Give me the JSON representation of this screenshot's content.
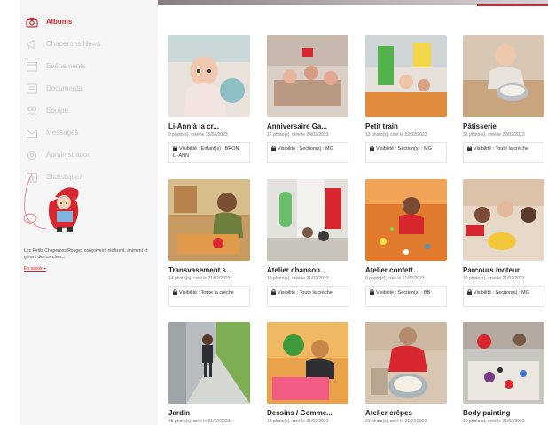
{
  "nav": [
    {
      "key": "albums",
      "label": "Albums",
      "icon": "camera-icon",
      "active": true
    },
    {
      "key": "chaperons-news",
      "label": "Chaperons News",
      "icon": "megaphone-icon",
      "active": false
    },
    {
      "key": "evenements",
      "label": "Evénements",
      "icon": "calendar-icon",
      "active": false
    },
    {
      "key": "documents",
      "label": "Documents",
      "icon": "document-icon",
      "active": false
    },
    {
      "key": "equipe",
      "label": "Equipe",
      "icon": "team-icon",
      "active": false
    },
    {
      "key": "messages",
      "label": "Messages",
      "icon": "envelope-icon",
      "active": false
    },
    {
      "key": "administration",
      "label": "Administration",
      "icon": "gear-icon",
      "active": false
    },
    {
      "key": "statistiques",
      "label": "Statistiques",
      "icon": "chart-icon",
      "active": false
    }
  ],
  "about": {
    "text": "Les Petits Chaperons Rouges conçoivent, réalisent, animent et gèrent des crèches...",
    "link": "En savoir +"
  },
  "colors": {
    "accent": "#d8262e",
    "sidebar_bg": "#f6f6f6"
  },
  "albums": [
    {
      "title": "Li-Ann à la cr...",
      "meta": "9 photo(s), créé le 15/03/2023",
      "visibility": "Visibilité : Enfant(s) : BRON LI-ANN"
    },
    {
      "title": "Anniversaire Ga...",
      "meta": "17 photo(s), créé le 24/02/2023",
      "visibility": "Visibilité : Section(s) : MG"
    },
    {
      "title": "Petit train",
      "meta": "13 photo(s), créé le 22/02/2023",
      "visibility": "Visibilité : Section(s) : MG"
    },
    {
      "title": "Pâtisserie",
      "meta": "31 photo(s), créé le 22/02/2023",
      "visibility": "Visibilité : Toute la crèche"
    },
    {
      "title": "Transvasement s...",
      "meta": "14 photo(s), créé le 21/02/2023",
      "visibility": "Visibilité : Toute la crèche"
    },
    {
      "title": "Atelier chanson...",
      "meta": "18 photo(s), créé le 21/02/2023",
      "visibility": "Visibilité : Toute la crèche"
    },
    {
      "title": "Atelier confett...",
      "meta": "9 photo(s), créé le 21/02/2023",
      "visibility": "Visibilité : Section(s) : BB"
    },
    {
      "title": "Parcours moteur",
      "meta": "30 photo(s), créé le 21/02/2023",
      "visibility": "Visibilité : Section(s) : MG"
    },
    {
      "title": "Jardin",
      "meta": "45 photo(s), créé le 21/02/2023",
      "visibility": ""
    },
    {
      "title": "Dessins / Gomme...",
      "meta": "18 photo(s), créé le 21/02/2023",
      "visibility": ""
    },
    {
      "title": "Atelier crêpes",
      "meta": "21 photo(s), créé le 21/02/2023",
      "visibility": ""
    },
    {
      "title": "Body painting",
      "meta": "10 photo(s), créé le 21/02/2023",
      "visibility": ""
    }
  ]
}
